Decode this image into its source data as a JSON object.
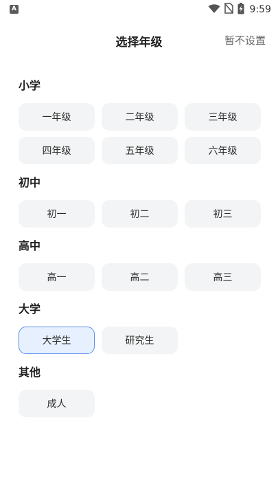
{
  "status_bar": {
    "left_icon_letter": "A",
    "time": "9:59",
    "icons": [
      "wifi-icon",
      "no-sim-icon",
      "battery-charging-icon"
    ]
  },
  "header": {
    "title": "选择年级",
    "skip_label": "暂不设置"
  },
  "sections": [
    {
      "title": "小学",
      "options": [
        {
          "label": "一年级",
          "selected": false
        },
        {
          "label": "二年级",
          "selected": false
        },
        {
          "label": "三年级",
          "selected": false
        },
        {
          "label": "四年级",
          "selected": false
        },
        {
          "label": "五年级",
          "selected": false
        },
        {
          "label": "六年级",
          "selected": false
        }
      ]
    },
    {
      "title": "初中",
      "options": [
        {
          "label": "初一",
          "selected": false
        },
        {
          "label": "初二",
          "selected": false
        },
        {
          "label": "初三",
          "selected": false
        }
      ]
    },
    {
      "title": "高中",
      "options": [
        {
          "label": "高一",
          "selected": false
        },
        {
          "label": "高二",
          "selected": false
        },
        {
          "label": "高三",
          "selected": false
        }
      ]
    },
    {
      "title": "大学",
      "options": [
        {
          "label": "大学生",
          "selected": true
        },
        {
          "label": "研究生",
          "selected": false
        }
      ]
    },
    {
      "title": "其他",
      "options": [
        {
          "label": "成人",
          "selected": false
        }
      ]
    }
  ],
  "colors": {
    "chip_bg": "#f3f4f5",
    "chip_selected_bg": "#e6f0ff",
    "chip_selected_border": "#5b8eea",
    "text": "#222222",
    "skip_text": "#666666"
  }
}
